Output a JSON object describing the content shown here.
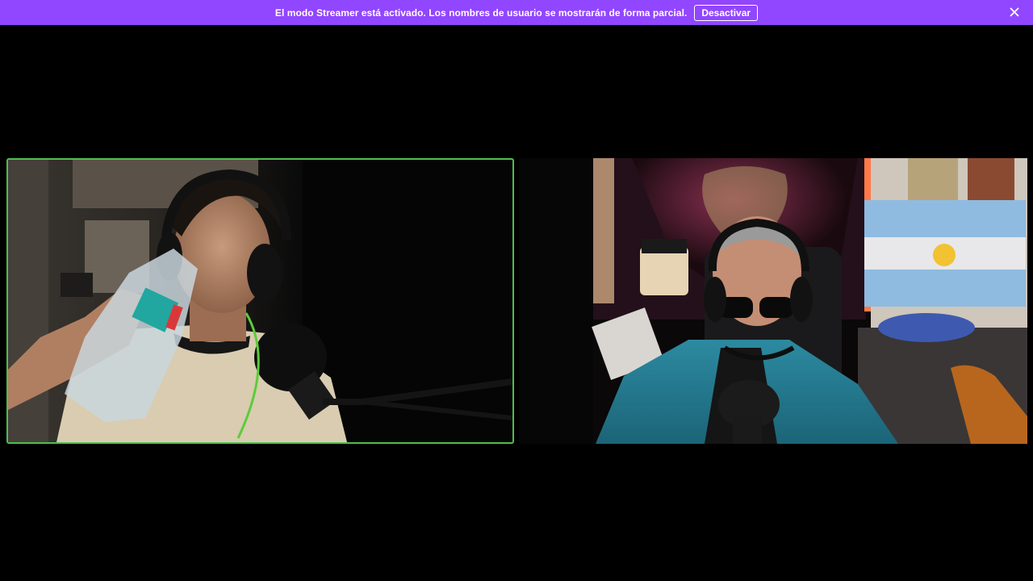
{
  "banner": {
    "message": "El modo Streamer está activado. Los nombres de usuario se mostrarán de forma parcial.",
    "action_label": "Desactivar",
    "close_icon": "close-icon",
    "background_color": "#9146ff"
  },
  "feeds": {
    "active_speaker_border_color": "#4fbf4f"
  }
}
